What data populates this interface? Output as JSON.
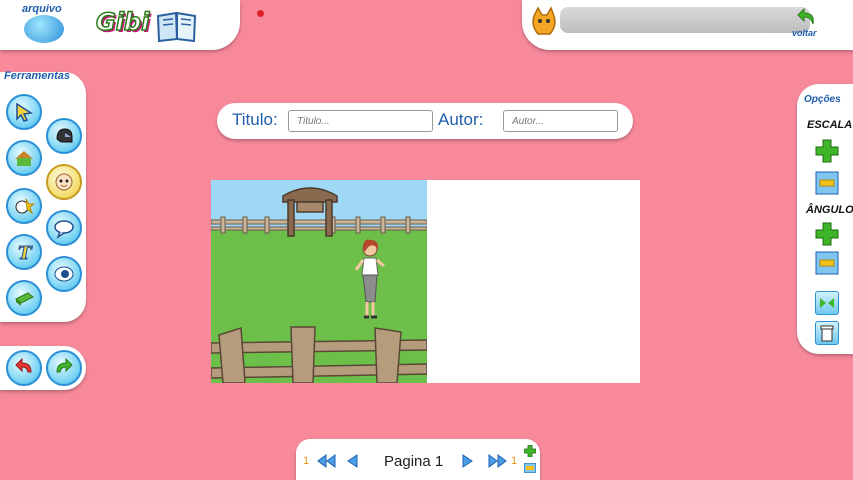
{
  "app": {
    "arquivo_label": "arquivo",
    "logo_text": "Gibi"
  },
  "header": {
    "voltar_label": "voltar"
  },
  "tools": {
    "title": "Ferramentas",
    "items": [
      {
        "name": "cursor-icon"
      },
      {
        "name": "helmet-icon"
      },
      {
        "name": "scenery-icon"
      },
      {
        "name": "character-icon"
      },
      {
        "name": "objects-icon"
      },
      {
        "name": "speech-balloon-icon"
      },
      {
        "name": "text-icon"
      },
      {
        "name": "eye-icon"
      },
      {
        "name": "paper-icon"
      }
    ]
  },
  "form": {
    "title_label": "Titulo:",
    "title_placeholder": "Titulo...",
    "author_label": "Autor:",
    "author_placeholder": "Autor..."
  },
  "options": {
    "title": "Opções",
    "scale_label": "ESCALA",
    "angle_label": "ÂNGULO"
  },
  "pager": {
    "first_num": "1",
    "last_num": "1",
    "page_label": "Pagina 1"
  },
  "colors": {
    "background": "#f7899b",
    "accent_blue": "#1f5fae",
    "green_button": "#3fb52a"
  }
}
